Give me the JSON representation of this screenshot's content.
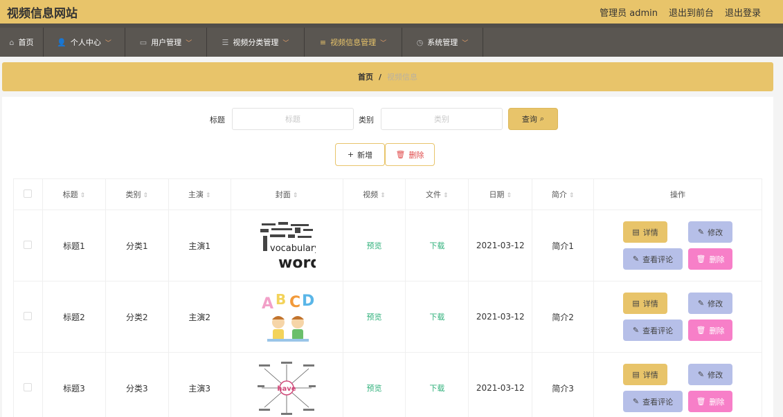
{
  "header": {
    "brand": "视频信息网站",
    "admin_label": "管理员 admin",
    "to_front": "退出到前台",
    "logout": "退出登录"
  },
  "nav": {
    "items": [
      {
        "label": "首页",
        "icon": "home-icon"
      },
      {
        "label": "个人中心",
        "icon": "user-icon"
      },
      {
        "label": "用户管理",
        "icon": "id-card-icon"
      },
      {
        "label": "视频分类管理",
        "icon": "sliders-icon"
      },
      {
        "label": "视频信息管理",
        "icon": "list-icon"
      },
      {
        "label": "系统管理",
        "icon": "clock-icon"
      }
    ]
  },
  "breadcrumb": {
    "home": "首页",
    "sep": "/",
    "current": "视频信息"
  },
  "search": {
    "title_label": "标题",
    "title_placeholder": "标题",
    "category_label": "类别",
    "category_placeholder": "类别",
    "query_label": "查询"
  },
  "toolbar": {
    "add_label": "新增",
    "delete_label": "删除"
  },
  "table": {
    "columns": [
      "标题",
      "类别",
      "主演",
      "封面",
      "视频",
      "文件",
      "日期",
      "简介",
      "操作"
    ],
    "rows": [
      {
        "title": "标题1",
        "category": "分类1",
        "actor": "主演1",
        "video": "预览",
        "file": "下载",
        "date": "2021-03-12",
        "intro": "简介1"
      },
      {
        "title": "标题2",
        "category": "分类2",
        "actor": "主演2",
        "video": "预览",
        "file": "下载",
        "date": "2021-03-12",
        "intro": "简介2"
      },
      {
        "title": "标题3",
        "category": "分类3",
        "actor": "主演3",
        "video": "预览",
        "file": "下载",
        "date": "2021-03-12",
        "intro": "简介3"
      }
    ],
    "ops": {
      "detail": "详情",
      "edit": "修改",
      "comment": "查看评论",
      "delete": "删除"
    }
  },
  "covers": {
    "c1_big": "words",
    "c1_mid": "vocabulary",
    "c2_a": "A",
    "c2_b": "B",
    "c2_c": "C",
    "c2_d": "D",
    "c3_center": "have"
  },
  "colors": {
    "accent": "#e8c46a",
    "nav_bg": "#5a5651",
    "edit_bg": "#b6bfe8",
    "delete_bg": "#f77fc8"
  }
}
